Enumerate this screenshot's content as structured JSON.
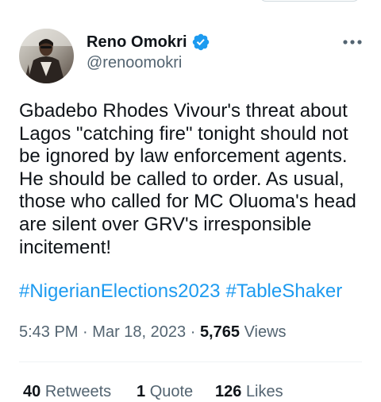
{
  "author": {
    "display_name": "Reno Omokri",
    "handle": "@renoomokri",
    "verified": true,
    "avatar_icon": "avatar-photo"
  },
  "tweet": {
    "text": "Gbadebo Rhodes Vivour's threat about Lagos \"catching fire\" tonight should not be ignored by law enforcement agents. He should be called to order. As usual, those who called for MC Oluoma's head are silent over GRV's irresponsible incitement!",
    "hashtags": [
      "#NigerianElections2023",
      "#TableShaker"
    ]
  },
  "meta": {
    "time": "5:43 PM",
    "separator": "·",
    "date": "Mar 18, 2023",
    "views_count": "5,765",
    "views_label": "Views"
  },
  "stats": {
    "retweets_count": "40",
    "retweets_label": "Retweets",
    "quotes_count": "1",
    "quotes_label": "Quote",
    "likes_count": "126",
    "likes_label": "Likes"
  },
  "icons": {
    "more": "more-horizontal-icon",
    "verified": "verified-badge-icon"
  },
  "colors": {
    "link": "#1d9bf0",
    "text_primary": "#0f1419",
    "text_secondary": "#536471",
    "verified": "#1d9bf0",
    "divider": "#eff3f4"
  }
}
